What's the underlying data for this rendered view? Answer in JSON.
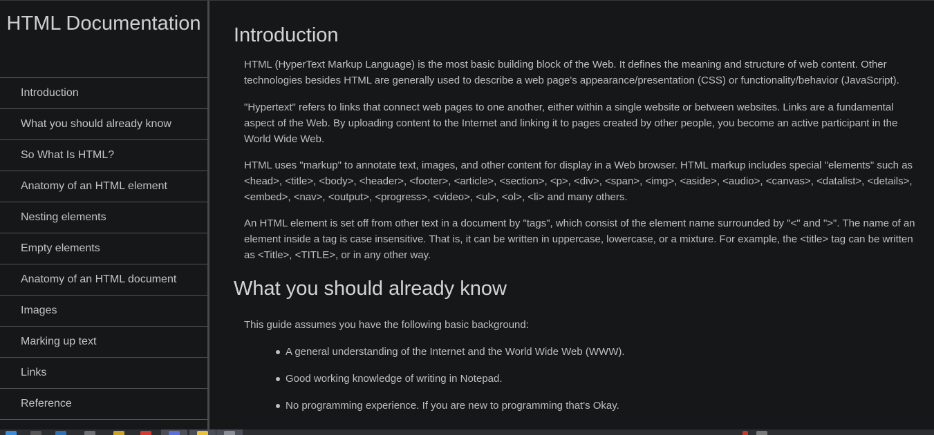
{
  "sidebar": {
    "title": "HTML Documentation",
    "items": [
      {
        "label": "Introduction"
      },
      {
        "label": "What you should already know"
      },
      {
        "label": "So What Is HTML?"
      },
      {
        "label": "Anatomy of an HTML element"
      },
      {
        "label": "Nesting elements"
      },
      {
        "label": "Empty elements"
      },
      {
        "label": "Anatomy of an HTML document"
      },
      {
        "label": "Images"
      },
      {
        "label": "Marking up text"
      },
      {
        "label": "Links"
      },
      {
        "label": "Reference"
      }
    ]
  },
  "main": {
    "sections": [
      {
        "title": "Introduction",
        "paragraphs": [
          "HTML (HyperText Markup Language) is the most basic building block of the Web. It defines the meaning and structure of web content. Other technologies besides HTML are generally used to describe a web page's appearance/presentation (CSS) or functionality/behavior (JavaScript).",
          "\"Hypertext\" refers to links that connect web pages to one another, either within a single website or between websites. Links are a fundamental aspect of the Web. By uploading content to the Internet and linking it to pages created by other people, you become an active participant in the World Wide Web.",
          "HTML uses \"markup\" to annotate text, images, and other content for display in a Web browser. HTML markup includes special \"elements\" such as <head>, <title>, <body>, <header>, <footer>, <article>, <section>, <p>, <div>, <span>, <img>, <aside>, <audio>, <canvas>, <datalist>, <details>, <embed>, <nav>, <output>, <progress>, <video>, <ul>, <ol>, <li> and many others.",
          "An HTML element is set off from other text in a document by \"tags\", which consist of the element name surrounded by \"<\" and \">\". The name of an element inside a tag is case insensitive. That is, it can be written in uppercase, lowercase, or a mixture. For example, the <title> tag can be written as <Title>, <TITLE>, or in any other way."
        ]
      },
      {
        "title": "What you should already know",
        "intro": "This guide assumes you have the following basic background:",
        "bullets": [
          "A general understanding of the Internet and the World Wide Web (WWW).",
          "Good working knowledge of writing in Notepad.",
          "No programming experience. If you are new to programming that's Okay."
        ]
      }
    ]
  },
  "colors": {
    "background": "#161719",
    "text": "#bfbfbf",
    "heading": "#d4d4d4",
    "divider": "#555555",
    "taskbar": "#2b2d31"
  }
}
